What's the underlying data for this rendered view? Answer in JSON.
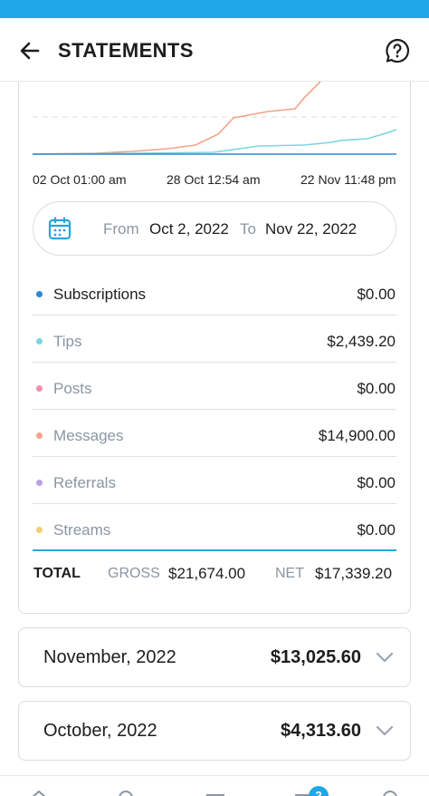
{
  "header": {
    "title": "STATEMENTS",
    "back_icon": "arrow-left-icon",
    "help_icon": "question-circle-icon"
  },
  "chart_data": {
    "type": "line",
    "x": [
      "02 Oct 01:00 am",
      "28 Oct 12:54 am",
      "22 Nov 11:48 pm"
    ],
    "series": [
      {
        "color": "#f2a488",
        "values": [
          0,
          25,
          40,
          120,
          390,
          450
        ]
      },
      {
        "color": "#79d6e0",
        "values": [
          0,
          5,
          10,
          30,
          60,
          95
        ]
      },
      {
        "color": "#2f86d6",
        "values": [
          0,
          0,
          0,
          0,
          0,
          0
        ]
      }
    ],
    "grid": "dashed reference line"
  },
  "range": {
    "icon": "calendar-icon",
    "from_label": "From",
    "from_value": "Oct 2, 2022",
    "to_label": "To",
    "to_value": "Nov 22, 2022"
  },
  "breakdown": [
    {
      "label": "Subscriptions",
      "value": "$0.00",
      "color": "#2f86d6"
    },
    {
      "label": "Tips",
      "value": "$2,439.20",
      "color": "#79d6e0"
    },
    {
      "label": "Posts",
      "value": "$0.00",
      "color": "#ef8fa8"
    },
    {
      "label": "Messages",
      "value": "$14,900.00",
      "color": "#f2a488"
    },
    {
      "label": "Referrals",
      "value": "$0.00",
      "color": "#b9a1e8"
    },
    {
      "label": "Streams",
      "value": "$0.00",
      "color": "#f4cf72"
    }
  ],
  "totals": {
    "total_label": "TOTAL",
    "gross_label": "GROSS",
    "gross_value": "$21,674.00",
    "net_label": "NET",
    "net_value": "$17,339.20"
  },
  "months": [
    {
      "name": "November, 2022",
      "amount": "$13,025.60"
    },
    {
      "name": "October, 2022",
      "amount": "$4,313.60"
    }
  ],
  "nav": {
    "badge": "2"
  }
}
